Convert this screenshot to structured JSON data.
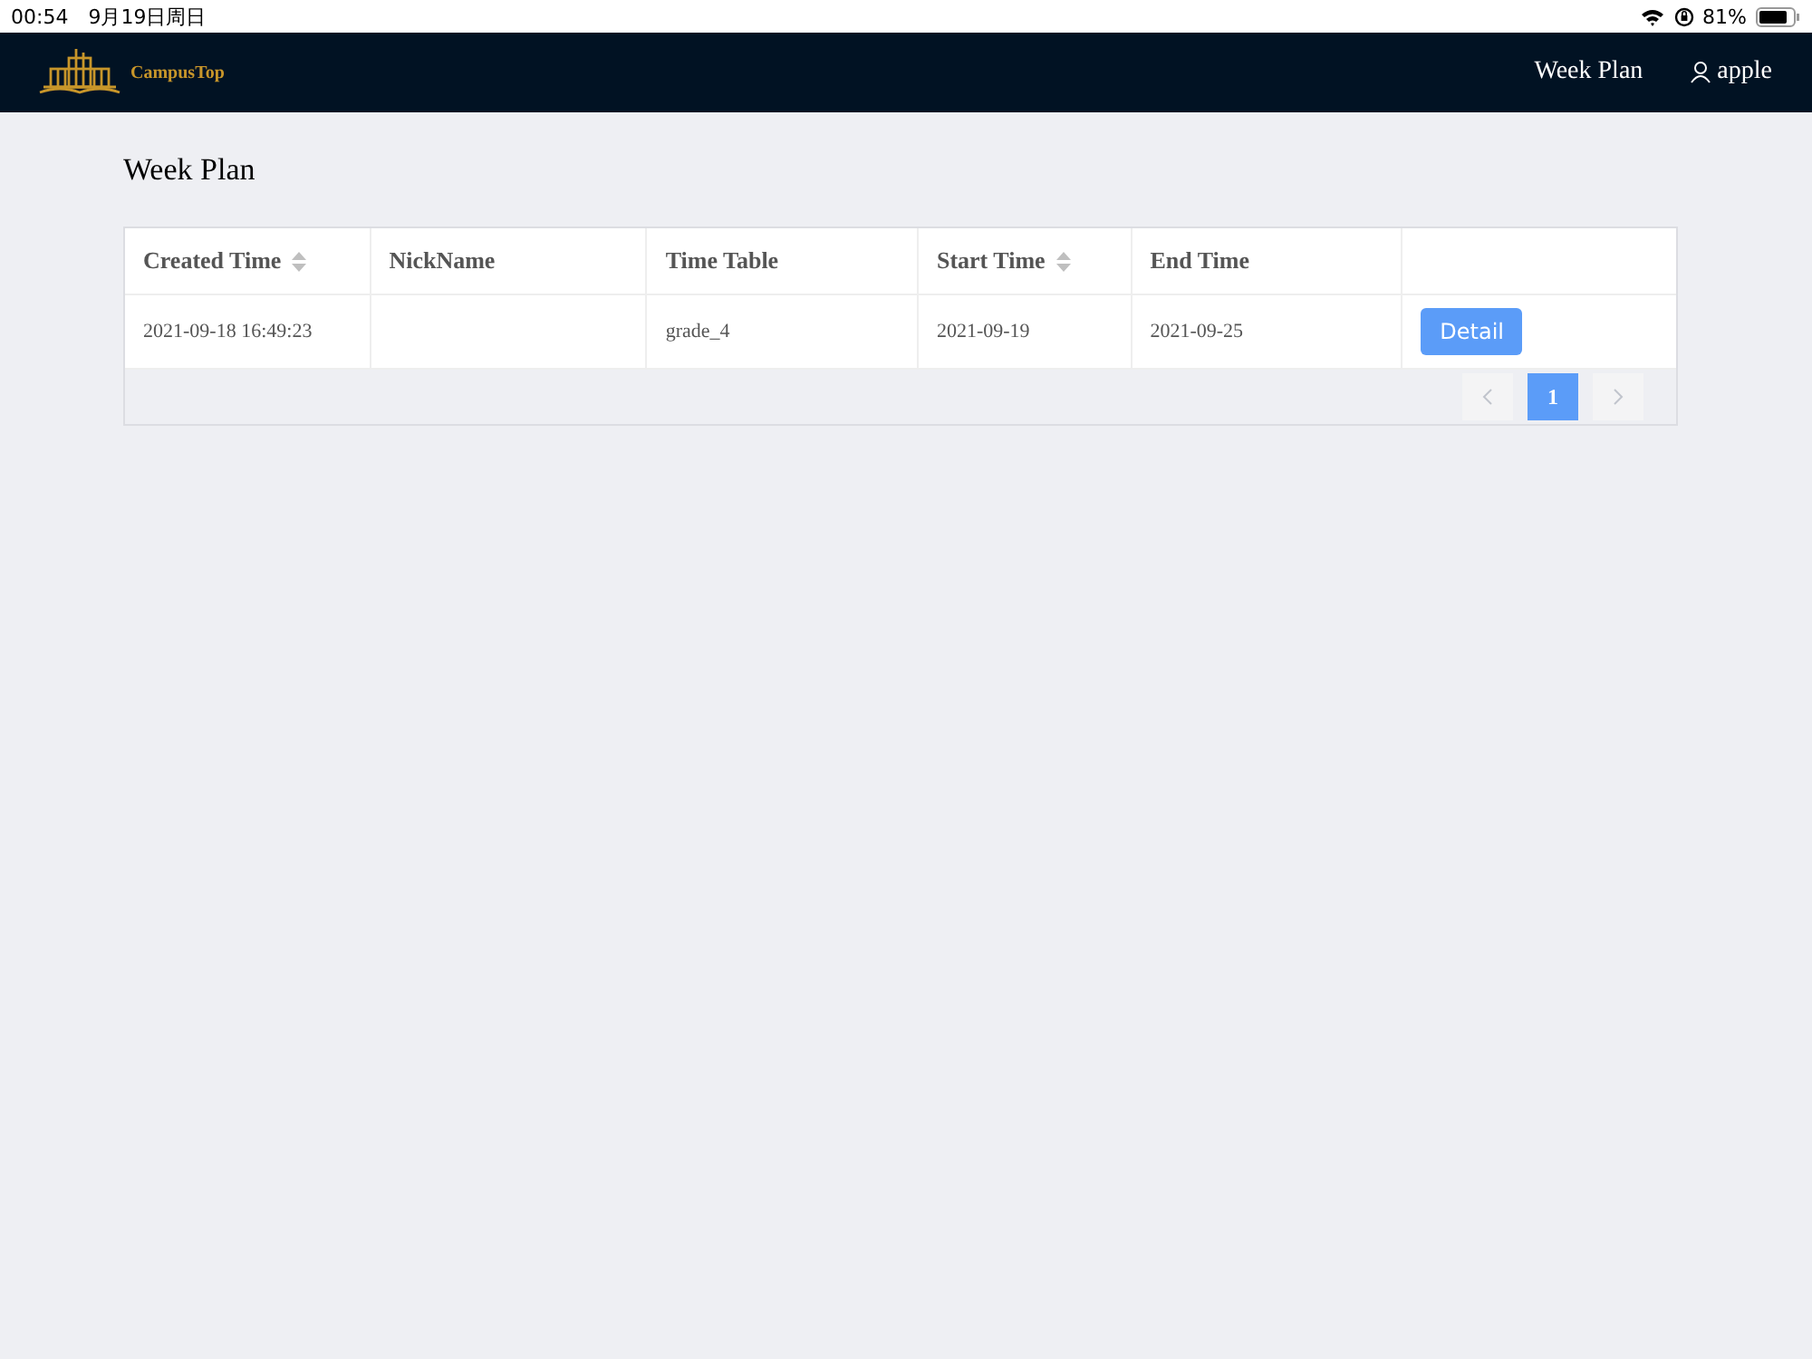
{
  "status_bar": {
    "time": "00:54",
    "date": "9月19日周日",
    "battery": "81%"
  },
  "navbar": {
    "logo_text": "CampusTop",
    "links": [
      {
        "label": "Week Plan"
      }
    ],
    "user": "apple"
  },
  "page_title": "Week Plan",
  "table": {
    "columns": [
      {
        "label": "Created Time",
        "sortable": true
      },
      {
        "label": "NickName",
        "sortable": false
      },
      {
        "label": "Time Table",
        "sortable": false
      },
      {
        "label": "Start Time",
        "sortable": true
      },
      {
        "label": "End Time",
        "sortable": false
      }
    ],
    "rows": [
      {
        "cells": [
          "2021-09-18 16:49:23",
          "",
          "grade_4",
          "2021-09-19",
          "2021-09-25"
        ],
        "action": "Detail"
      }
    ]
  },
  "pagination": {
    "prev_disabled": true,
    "next_disabled": true,
    "pages": [
      {
        "label": "1",
        "selected": true
      }
    ]
  }
}
